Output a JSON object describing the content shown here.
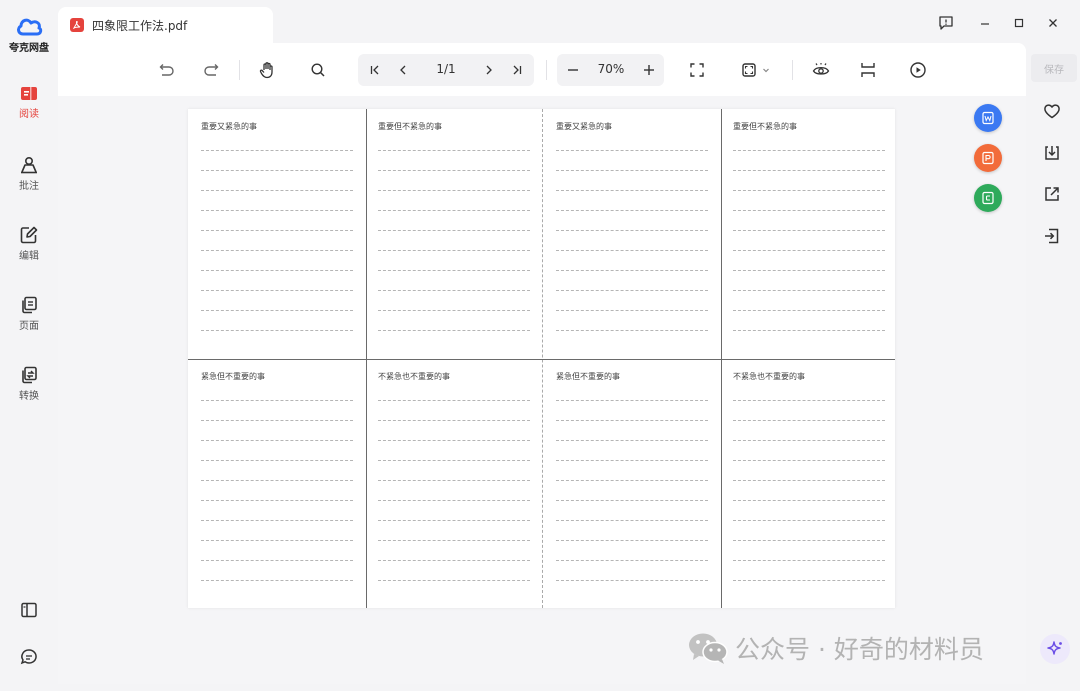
{
  "app": {
    "brand_name": "夸克网盘",
    "file_name": "四象限工作法.pdf"
  },
  "sidebar": {
    "items": [
      {
        "label": "阅读",
        "icon": "read-icon",
        "active": true
      },
      {
        "label": "批注",
        "icon": "annotate-icon",
        "active": false
      },
      {
        "label": "编辑",
        "icon": "edit-icon",
        "active": false
      },
      {
        "label": "页面",
        "icon": "pages-icon",
        "active": false
      },
      {
        "label": "转换",
        "icon": "convert-icon",
        "active": false
      }
    ]
  },
  "toolbar": {
    "page_indicator": "1/1",
    "zoom": "70%"
  },
  "right_rail": {
    "save_label": "保存"
  },
  "document": {
    "cells": [
      {
        "title": "重要又紧急的事"
      },
      {
        "title": "重要但不紧急的事"
      },
      {
        "title": "重要又紧急的事"
      },
      {
        "title": "重要但不紧急的事"
      },
      {
        "title": "紧急但不重要的事"
      },
      {
        "title": "不紧急也不重要的事"
      },
      {
        "title": "紧急但不重要的事"
      },
      {
        "title": "不紧急也不重要的事"
      }
    ],
    "lines_per_cell": 10
  },
  "watermark": {
    "text": "公众号 · 好奇的材料员"
  },
  "colors": {
    "accent_red": "#e5433d",
    "brand_blue": "#2a6ef5",
    "word_blue": "#3b79f2",
    "ppt_orange": "#f26b3a",
    "excel_green": "#2eaa5b"
  }
}
